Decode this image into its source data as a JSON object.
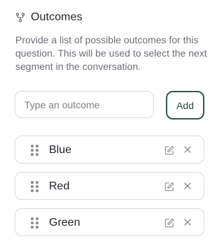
{
  "section": {
    "icon": "branch-icon",
    "title": "Outcomes",
    "description": "Provide a list of possible outcomes for this question. This will be used to select the next segment in the conversation."
  },
  "add_form": {
    "input_placeholder": "Type an outcome",
    "input_value": "",
    "add_label": "Add"
  },
  "outcomes": [
    {
      "label": "Blue"
    },
    {
      "label": "Red"
    },
    {
      "label": "Green"
    }
  ],
  "colors": {
    "accent_border": "#2f5a48",
    "muted_text": "#6b6f76",
    "border": "#d9dcdf",
    "icon": "#8a8e93"
  }
}
